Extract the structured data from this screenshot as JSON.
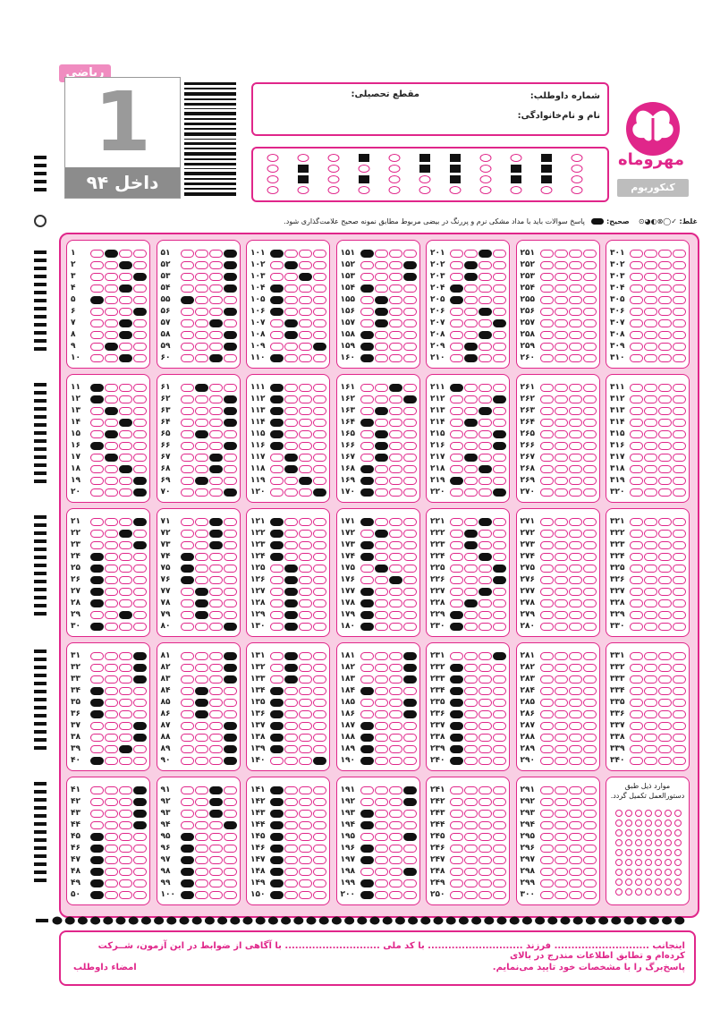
{
  "header": {
    "subject": "ریاضی",
    "booklet_number": "1",
    "booklet_label": "داخل ۹۴",
    "candidate_number_label": "شماره داوطلب:",
    "name_label": "نام و نام‌خانوادگی:",
    "grade_label": "مقطع تحصیلی:",
    "logo_text": "مهروماه",
    "brand_text": "کنکوریوم"
  },
  "instructions": {
    "wrong_label": "غلط:",
    "right_label": "صحیح:",
    "text": "پاسخ سوالات باید با مداد مشکی نرم و پررنگ در بیضی مربوط مطابق نمونه صحیح علامت‌گذاری شود."
  },
  "notes_block": {
    "text": "موارد ذیل طبق دستورالعمل تکمیل گردد."
  },
  "footer": {
    "line1": "اینجانب ............................ فرزند ............................ با کد ملی ............................ با آگاهی از ضوابط در این آزمون، شــرکت کرده‌ام و تطابق اطلاعات مندرج در بالای",
    "line2": "پاسخ‌برگ را با مشخصات خود تایید می‌نمایم.",
    "signature": "امضاء داوطلب"
  },
  "colors": {
    "accent": "#e0268a",
    "sheet_bg": "#f9cfe4"
  },
  "answers": {
    "1": 2,
    "2": 3,
    "3": 4,
    "4": 3,
    "5": 1,
    "6": 4,
    "7": 3,
    "8": 3,
    "9": 2,
    "10": 3,
    "11": 1,
    "12": 1,
    "13": 2,
    "14": 3,
    "15": 2,
    "16": 1,
    "17": 2,
    "18": 3,
    "19": 4,
    "20": 4,
    "21": 4,
    "22": 3,
    "23": 4,
    "24": 1,
    "25": 1,
    "26": 1,
    "27": 1,
    "28": 1,
    "29": 3,
    "30": 1,
    "31": 4,
    "32": 4,
    "33": 4,
    "34": 1,
    "35": 1,
    "36": 1,
    "37": 4,
    "38": 4,
    "39": 3,
    "40": 1,
    "41": 4,
    "42": 4,
    "43": 4,
    "44": 4,
    "45": 1,
    "46": 1,
    "47": 1,
    "48": 1,
    "49": 1,
    "50": 1,
    "51": 4,
    "52": 4,
    "53": 4,
    "54": 4,
    "55": 1,
    "56": 4,
    "57": 3,
    "58": 4,
    "59": 4,
    "60": 3,
    "61": 2,
    "62": 4,
    "63": 4,
    "64": 4,
    "65": 2,
    "66": 4,
    "67": 3,
    "68": 3,
    "69": 2,
    "70": 4,
    "71": 3,
    "72": 3,
    "73": 3,
    "74": 1,
    "75": 1,
    "76": 1,
    "77": 2,
    "78": 2,
    "79": 2,
    "80": 4,
    "81": 4,
    "82": 4,
    "83": 4,
    "84": 2,
    "85": 2,
    "86": 2,
    "87": 4,
    "88": 4,
    "89": 4,
    "90": 4,
    "91": 3,
    "92": 3,
    "93": 3,
    "94": 4,
    "95": 1,
    "96": 1,
    "97": 1,
    "98": 1,
    "99": 1,
    "100": 1,
    "101": 1,
    "102": 2,
    "103": 3,
    "104": 1,
    "105": 1,
    "106": 1,
    "107": 2,
    "108": 2,
    "109": 4,
    "110": 1,
    "111": 1,
    "112": 1,
    "113": 1,
    "114": 1,
    "115": 1,
    "116": 1,
    "117": 2,
    "118": 2,
    "119": 3,
    "120": 4,
    "121": 1,
    "122": 1,
    "123": 1,
    "124": 1,
    "125": 2,
    "126": 2,
    "127": 2,
    "128": 2,
    "129": 2,
    "130": 2,
    "131": 2,
    "132": 2,
    "133": 2,
    "134": 1,
    "135": 1,
    "136": 1,
    "137": 1,
    "138": 1,
    "139": 1,
    "140": 4,
    "141": 1,
    "142": 1,
    "143": 1,
    "144": 1,
    "145": 1,
    "146": 1,
    "147": 1,
    "148": 1,
    "149": 1,
    "150": 1,
    "151": 1,
    "152": 4,
    "153": 4,
    "154": 1,
    "155": 2,
    "156": 2,
    "157": 2,
    "158": 1,
    "159": 1,
    "160": 1,
    "161": 3,
    "162": 4,
    "163": 2,
    "164": 1,
    "165": 2,
    "166": 2,
    "167": 2,
    "168": 1,
    "169": 1,
    "170": 1,
    "171": 1,
    "172": 2,
    "173": 1,
    "174": 1,
    "175": 2,
    "176": 3,
    "177": 1,
    "178": 1,
    "179": 1,
    "180": 1,
    "181": 4,
    "182": 4,
    "183": 4,
    "184": 1,
    "185": 4,
    "186": 4,
    "187": 1,
    "188": 1,
    "189": 1,
    "190": 1,
    "191": 4,
    "192": 4,
    "193": 1,
    "194": 1,
    "195": 4,
    "196": 1,
    "197": 1,
    "198": 4,
    "199": 1,
    "200": 1,
    "201": 3,
    "202": 2,
    "203": 2,
    "204": 1,
    "205": 1,
    "206": 3,
    "207": 4,
    "208": 3,
    "209": 2,
    "210": 2,
    "211": 1,
    "212": 4,
    "213": 3,
    "214": 2,
    "215": 4,
    "216": 4,
    "217": 2,
    "218": 3,
    "219": 1,
    "220": 4,
    "221": 3,
    "222": 2,
    "223": 2,
    "224": 3,
    "225": 4,
    "226": 4,
    "227": 3,
    "228": 2,
    "229": 1,
    "230": 1,
    "231": 4,
    "232": 1,
    "233": 1,
    "234": 1,
    "235": 1,
    "236": 1,
    "237": 1,
    "238": 1,
    "239": 1,
    "240": 1
  },
  "blocks": [
    {
      "start": 1,
      "end": 10
    },
    {
      "start": 51,
      "end": 60
    },
    {
      "start": 101,
      "end": 110
    },
    {
      "start": 151,
      "end": 160
    },
    {
      "start": 201,
      "end": 210
    },
    {
      "start": 251,
      "end": 260
    },
    {
      "start": 301,
      "end": 310
    },
    {
      "start": 11,
      "end": 20
    },
    {
      "start": 61,
      "end": 70
    },
    {
      "start": 111,
      "end": 120
    },
    {
      "start": 161,
      "end": 170
    },
    {
      "start": 211,
      "end": 220
    },
    {
      "start": 261,
      "end": 270
    },
    {
      "start": 311,
      "end": 320
    },
    {
      "start": 21,
      "end": 30
    },
    {
      "start": 71,
      "end": 80
    },
    {
      "start": 121,
      "end": 130
    },
    {
      "start": 171,
      "end": 180
    },
    {
      "start": 221,
      "end": 230
    },
    {
      "start": 271,
      "end": 280
    },
    {
      "start": 321,
      "end": 330
    },
    {
      "start": 31,
      "end": 40
    },
    {
      "start": 81,
      "end": 90
    },
    {
      "start": 131,
      "end": 140
    },
    {
      "start": 181,
      "end": 190
    },
    {
      "start": 231,
      "end": 240
    },
    {
      "start": 281,
      "end": 290
    },
    {
      "start": 331,
      "end": 340
    },
    {
      "start": 41,
      "end": 50
    },
    {
      "start": 91,
      "end": 100
    },
    {
      "start": 141,
      "end": 150
    },
    {
      "start": 191,
      "end": 200
    },
    {
      "start": 241,
      "end": 250
    },
    {
      "start": 291,
      "end": 300
    }
  ]
}
